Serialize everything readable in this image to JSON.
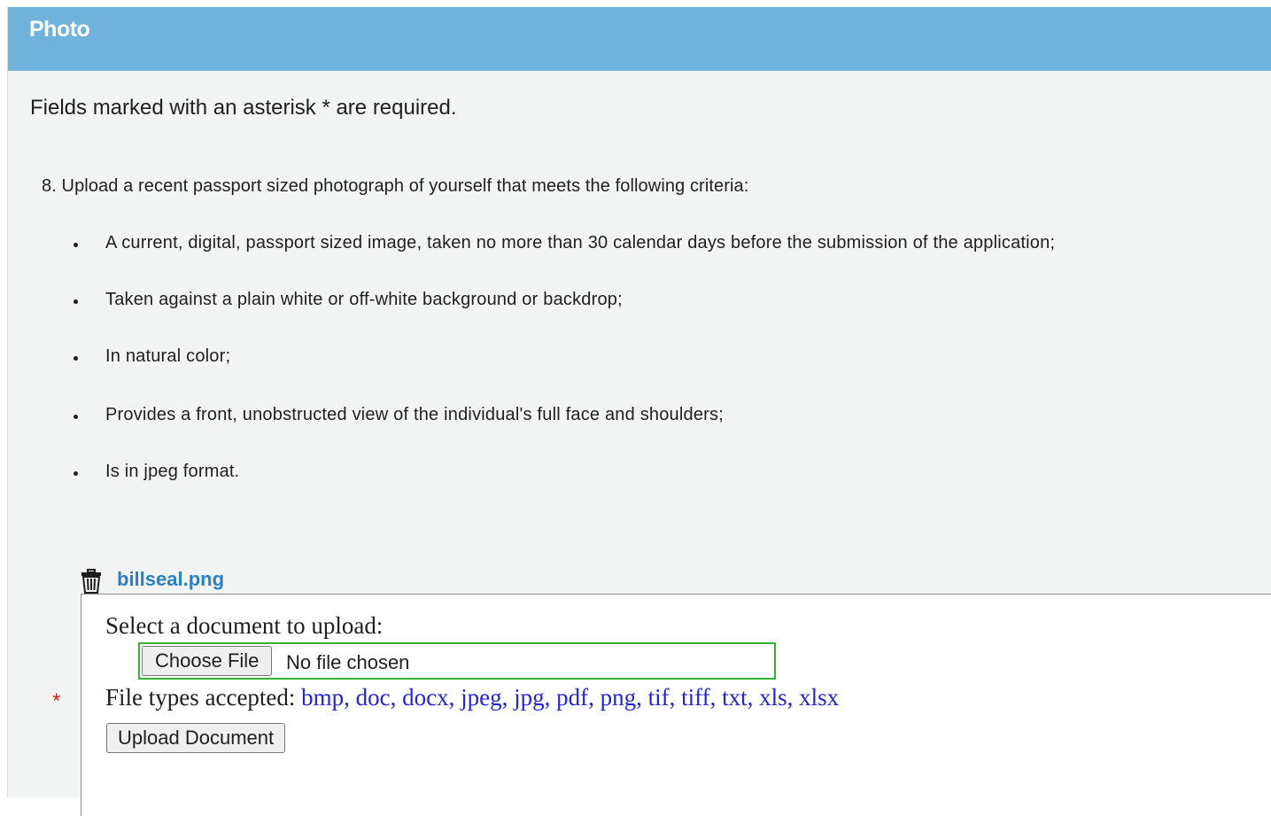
{
  "panel": {
    "title": "Photo",
    "required_note": "Fields marked with an asterisk * are required."
  },
  "question": {
    "text": "8. Upload a recent passport sized photograph of yourself that meets the following criteria:",
    "criteria": [
      "A current, digital, passport sized image, taken no more than 30 calendar days before the submission of the application;",
      "Taken against a plain white or off-white background or backdrop;",
      "In natural color;",
      "Provides a front, unobstructed view of the individual's full face and shoulders;",
      "Is in jpeg format."
    ]
  },
  "uploaded_file": {
    "name": "billseal.png",
    "icon": "trash-icon"
  },
  "upload": {
    "select_label": "Select a document to upload:",
    "choose_button": "Choose File",
    "no_file_text": "No file chosen",
    "types_label": "File types accepted:",
    "types_values": "bmp, doc, docx, jpeg, jpg, pdf, png, tif, tiff, txt, xls, xlsx",
    "upload_button": "Upload Document",
    "required_marker": "*"
  },
  "colors": {
    "header": "#6fb3dd",
    "link": "#2b7fc9",
    "file_types": "#2323e0",
    "input_focus_border": "#33b233",
    "required": "#e02020"
  }
}
